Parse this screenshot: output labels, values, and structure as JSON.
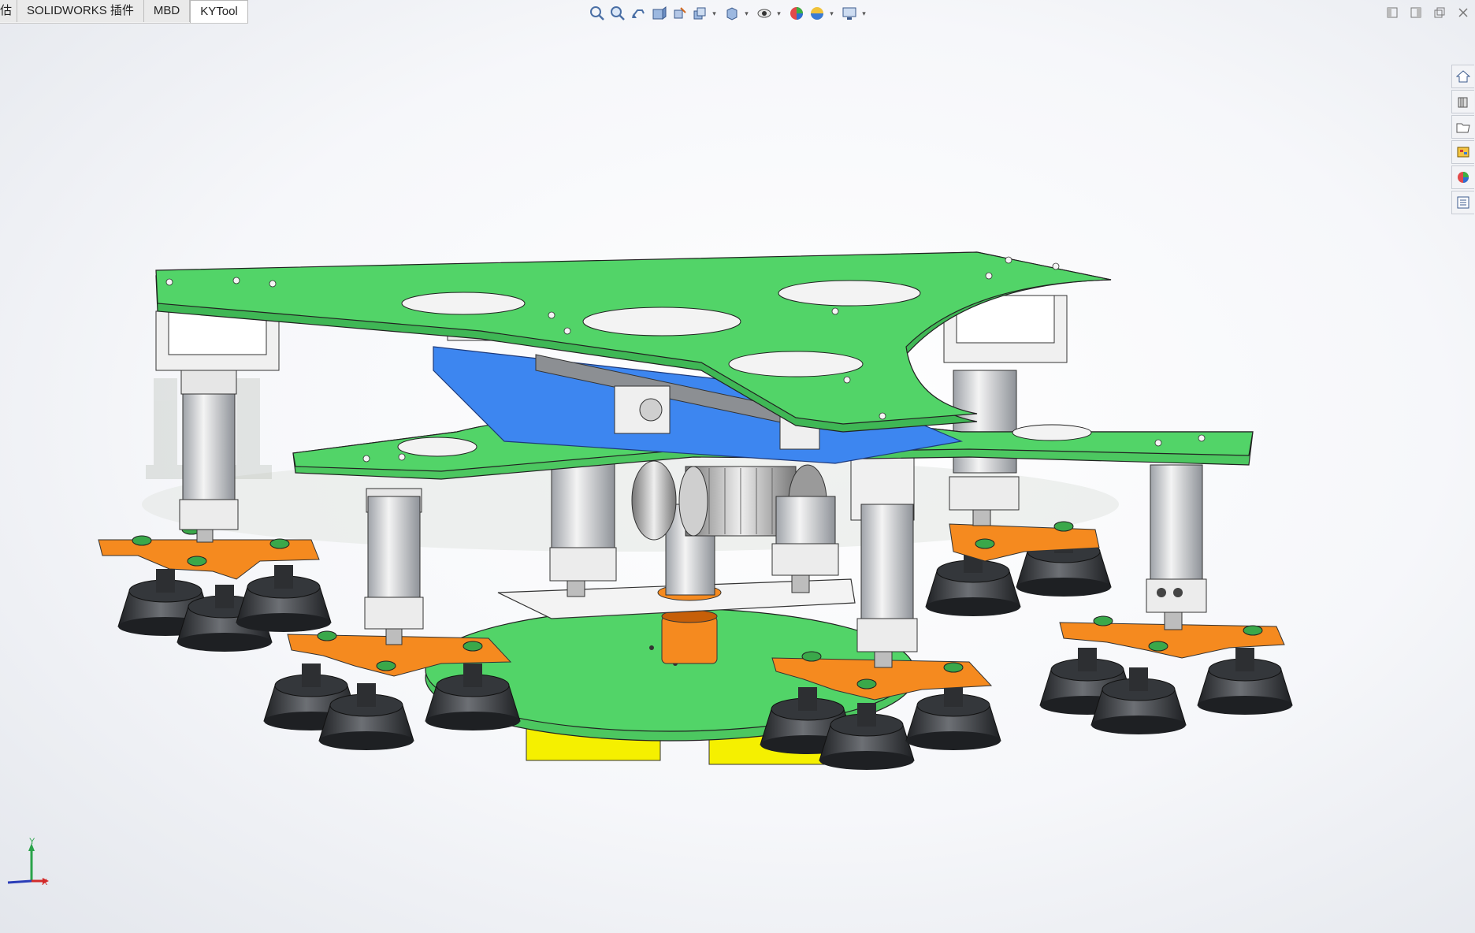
{
  "command_manager": {
    "tabs": [
      {
        "label": "估",
        "active": false
      },
      {
        "label": "SOLIDWORKS 插件",
        "active": false
      },
      {
        "label": "MBD",
        "active": false
      },
      {
        "label": "KYTool",
        "active": true
      }
    ]
  },
  "heads_up_toolbar": {
    "icons": [
      "zoom-to-fit-icon",
      "zoom-to-area-icon",
      "previous-view-icon",
      "section-view-icon",
      "dynamic-annotation-icon",
      "view-orientation-icon",
      "display-style-icon",
      "hide-show-items-icon",
      "edit-appearance-icon",
      "apply-scene-icon",
      "view-settings-icon"
    ]
  },
  "task_pane": {
    "icons": [
      "solidworks-resources-icon",
      "design-library-icon",
      "file-explorer-icon",
      "view-palette-icon",
      "appearances-scenes-icon",
      "custom-properties-icon"
    ]
  },
  "triad": {
    "y_label": "Y",
    "x_label": "X"
  },
  "colors": {
    "green_plate": "#52d468",
    "orange_plate": "#f58a1f",
    "blue_plate": "#3d86f0",
    "yellow_block": "#f5f000",
    "cup_dark": "#2f3135",
    "steel": "#d8d8d8"
  }
}
